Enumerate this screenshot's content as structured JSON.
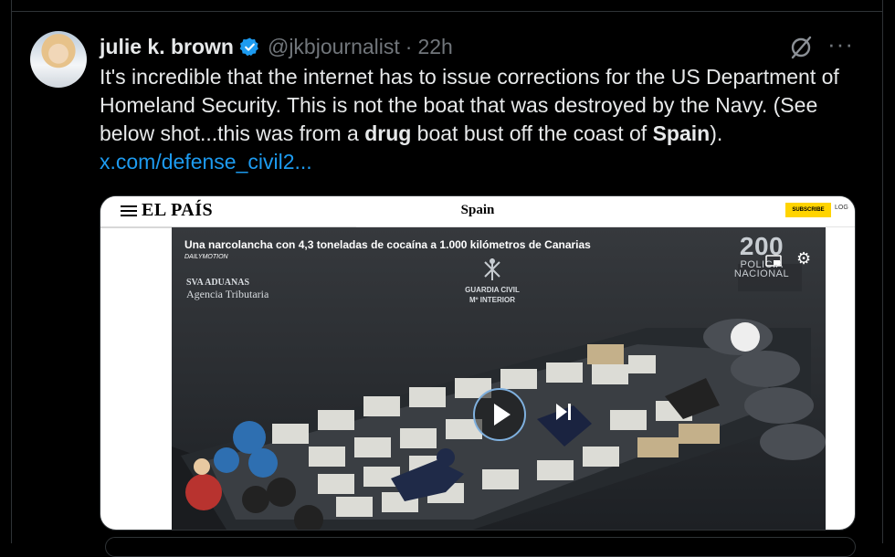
{
  "tweet": {
    "display_name": "julie k. brown",
    "handle": "@jkbjournalist",
    "separator": "·",
    "time": "22h",
    "text_part1": "It's incredible that the internet has to issue corrections for the US Department of Homeland Security. This is not the boat that was destroyed by the Navy. (See below shot...this was from a ",
    "bold_word1": "drug",
    "text_part2": " boat bust off the coast of ",
    "bold_word2": "Spain",
    "text_part3": ").  ",
    "link": "x.com/defense_civil2..."
  },
  "icons": {
    "verified": "verified-badge-icon",
    "grok": "grok-icon",
    "more": "more-icon",
    "play": "play-icon",
    "next": "next-icon",
    "cast": "cast-icon",
    "settings": "settings-icon"
  },
  "colors": {
    "background": "#000000",
    "text": "#e7e9ea",
    "muted": "#71767b",
    "link": "#1d9bf0",
    "verified": "#1d9bf0",
    "subscribe": "#ffd400"
  },
  "media": {
    "site_logo": "EL PAÍS",
    "section": "Spain",
    "subscribe_label": "SUBSCRIBE",
    "login_label": "LOG",
    "video": {
      "title": "Una narcolancha con 4,3 toneladas de cocaína a 1.000 kilómetros de Canarias",
      "brand": "DAILYMOTION",
      "agency_line1": "SVA ADUANAS",
      "agency_line2": "Agencia Tributaria",
      "guardia_line1": "GUARDIA CIVIL",
      "guardia_line2": "Mº INTERIOR",
      "policia_number": "200",
      "policia_line1": "POLICIA",
      "policia_line2": "NACIONAL"
    }
  }
}
